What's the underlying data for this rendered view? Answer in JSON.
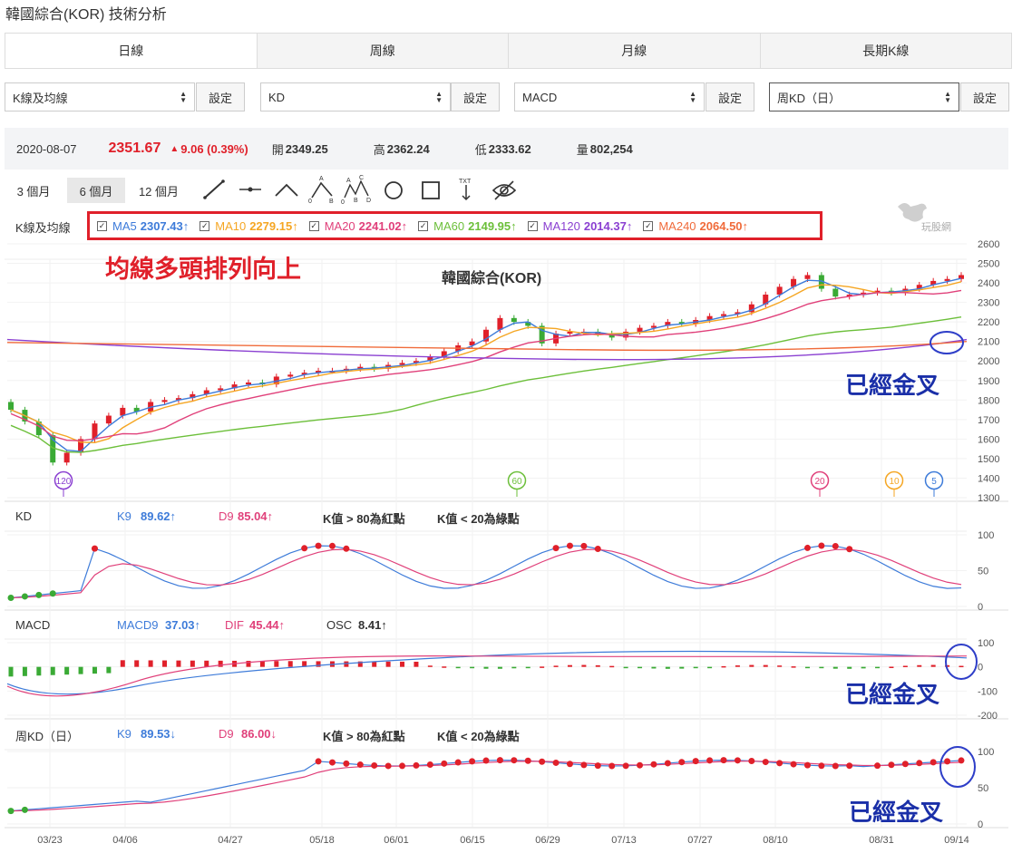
{
  "page_title": "韓國綜合(KOR) 技術分析",
  "tabs": [
    "日線",
    "周線",
    "月線",
    "長期K線"
  ],
  "selectors": [
    {
      "value": "K線及均線",
      "button": "設定"
    },
    {
      "value": "KD",
      "button": "設定"
    },
    {
      "value": "MACD",
      "button": "設定"
    },
    {
      "value": "周KD（日）",
      "button": "設定"
    }
  ],
  "quote": {
    "date": "2020-08-07",
    "price": "2351.67",
    "change": "9.06 (0.39%)",
    "open_label": "開",
    "open": "2349.25",
    "high_label": "高",
    "high": "2362.24",
    "low_label": "低",
    "low": "2333.62",
    "vol_label": "量",
    "vol": "802,254"
  },
  "ranges": [
    "3 個月",
    "6 個月",
    "12 個月"
  ],
  "tools": [
    "line-tool-icon",
    "horizontal-line-icon",
    "angle-tool-icon",
    "abc-pattern-icon",
    "abcd-pattern-icon",
    "circle-tool-icon",
    "rectangle-tool-icon",
    "text-tool-icon",
    "hide-eye-icon"
  ],
  "tool_text": {
    "a": "A",
    "b": "B",
    "c": "C",
    "d": "D",
    "zero": "0",
    "txt": "TXT"
  },
  "watermark": "玩股網",
  "main_panel": {
    "label": "K線及均線",
    "chart_title": "韓國綜合(KOR)",
    "ma": [
      {
        "name": "MA5",
        "value": "2307.43↑",
        "color": "#3d7bd9"
      },
      {
        "name": "MA10",
        "value": "2279.15↑",
        "color": "#f5a623"
      },
      {
        "name": "MA20",
        "value": "2241.02↑",
        "color": "#e0407a"
      },
      {
        "name": "MA60",
        "value": "2149.95↑",
        "color": "#6cbf3a"
      },
      {
        "name": "MA120",
        "value": "2014.37↑",
        "color": "#8a3fd1"
      },
      {
        "name": "MA240",
        "value": "2064.50↑",
        "color": "#f06b3a"
      }
    ],
    "y_ticks": [
      "2600",
      "2500",
      "2400",
      "2300",
      "2200",
      "2100",
      "2000",
      "1900",
      "1800",
      "1700",
      "1600",
      "1500",
      "1400",
      "1300"
    ],
    "markers": [
      {
        "label": "120",
        "color": "#8a3fd1"
      },
      {
        "label": "60",
        "color": "#6cbf3a"
      },
      {
        "label": "20",
        "color": "#e0407a"
      },
      {
        "label": "10",
        "color": "#f5a623"
      },
      {
        "label": "5",
        "color": "#3d7bd9"
      }
    ]
  },
  "kd_panel": {
    "label": "KD",
    "k_label": "K9",
    "k": "89.62↑",
    "d_label": "D9",
    "d": "85.04↑",
    "rule1": "K值 > 80為紅點",
    "rule2": "K值 < 20為綠點",
    "y_ticks": [
      "100",
      "50",
      "0"
    ]
  },
  "macd_panel": {
    "label": "MACD",
    "macd_label": "MACD9",
    "macd": "37.03↑",
    "dif_label": "DIF",
    "dif": "45.44↑",
    "osc_label": "OSC",
    "osc": "8.41↑",
    "y_ticks": [
      "100",
      "0",
      "-100",
      "-200"
    ]
  },
  "wkd_panel": {
    "label": "周KD（日）",
    "k_label": "K9",
    "k": "89.53↓",
    "d_label": "D9",
    "d": "86.00↓",
    "rule1": "K值 > 80為紅點",
    "rule2": "K值 < 20為綠點",
    "y_ticks": [
      "100",
      "50",
      "0"
    ]
  },
  "x_ticks": [
    "03/23",
    "04/06",
    "04/27",
    "05/18",
    "06/01",
    "06/15",
    "06/29",
    "07/13",
    "07/27",
    "08/10",
    "08/31",
    "09/14"
  ],
  "annotations": {
    "main_red": "均線多頭排列向上",
    "gold1": "已經金叉",
    "gold2": "已經金叉",
    "gold3": "已經金叉"
  },
  "colors": {
    "up": "#e0202a",
    "down": "#3aaa35",
    "annot_blue": "#1a2fa8",
    "annot_red": "#e0202a"
  },
  "chart_data": {
    "type": "line",
    "title": "韓國綜合(KOR)",
    "candles_close": [
      1750,
      1690,
      1620,
      1480,
      1530,
      1600,
      1680,
      1720,
      1760,
      1740,
      1790,
      1800,
      1810,
      1830,
      1850,
      1860,
      1880,
      1890,
      1880,
      1920,
      1930,
      1940,
      1950,
      1950,
      1960,
      1970,
      1960,
      1980,
      1990,
      2000,
      2020,
      2050,
      2080,
      2100,
      2160,
      2220,
      2200,
      2180,
      2090,
      2140,
      2150,
      2150,
      2140,
      2120,
      2150,
      2170,
      2180,
      2200,
      2190,
      2210,
      2230,
      2240,
      2250,
      2290,
      2340,
      2380,
      2420,
      2440,
      2370,
      2330,
      2340,
      2350,
      2360,
      2350,
      2370,
      2390,
      2410,
      2420,
      2440
    ]
  }
}
